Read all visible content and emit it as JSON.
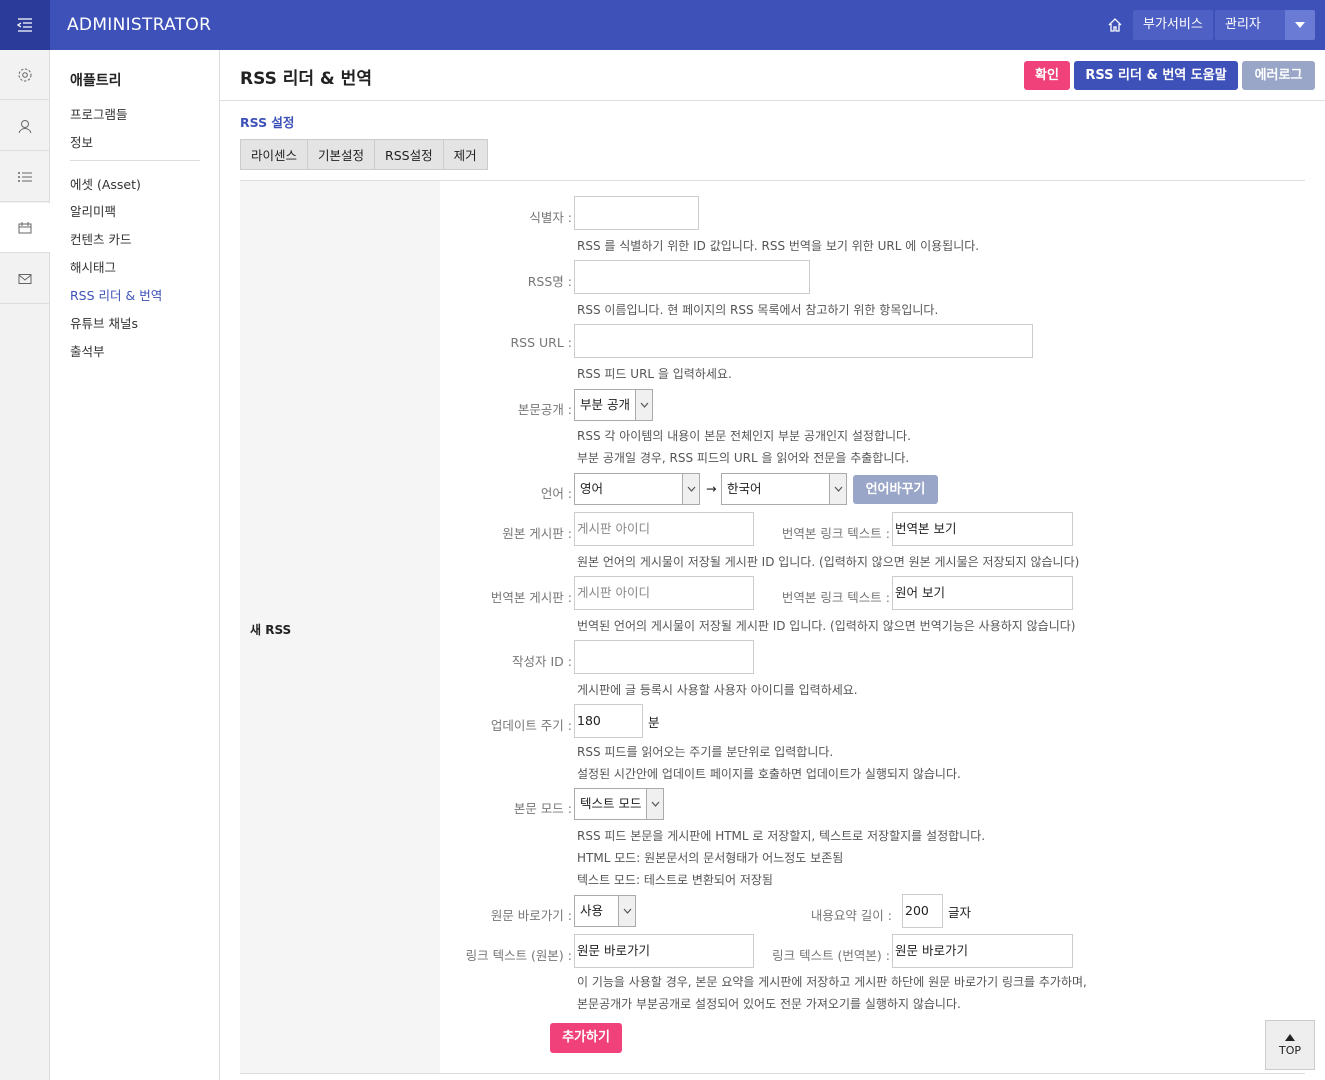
{
  "header": {
    "brand": "ADMINISTRATOR",
    "services_label": "부가서비스",
    "admin_label": "관리자"
  },
  "iconbar": [
    "gear-icon",
    "user-icon",
    "list-icon",
    "calendar-icon",
    "mail-icon"
  ],
  "sidebar": {
    "title": "애플트리",
    "items": [
      "프로그램들",
      "정보",
      "에셋 (Asset)",
      "알리미팩",
      "컨텐츠 카드",
      "해시태그",
      "RSS 리더 & 번역",
      "유튜브 채널s",
      "출석부"
    ]
  },
  "page": {
    "title": "RSS 리더 & 번역",
    "confirm_label": "확인",
    "help_label": "RSS 리더 & 번역 도움말",
    "errorlog_label": "에러로그",
    "section_label": "RSS 설정",
    "tabs": [
      "라이센스",
      "기본설정",
      "RSS설정",
      "제거"
    ]
  },
  "form": {
    "row_label": "새 RSS",
    "identifier_label": "식별자 :",
    "identifier_help": "RSS 를 식별하기 위한 ID 값입니다. RSS 번역을 보기 위한 URL 에 이용됩니다.",
    "rssname_label": "RSS명 :",
    "rssname_help": "RSS 이름입니다. 현 페이지의 RSS 목록에서 참고하기 위한 항목입니다.",
    "rssurl_label": "RSS URL :",
    "rssurl_help": "RSS 피드 URL 을 입력하세요.",
    "disclosure_label": "본문공개 :",
    "disclosure_value": "부분 공개",
    "disclosure_help1": "RSS 각 아이템의 내용이 본문 전체인지 부분 공개인지 설정합니다.",
    "disclosure_help2": "부분 공개일 경우, RSS 피드의 URL 을 읽어와 전문을 추출합니다.",
    "language_label": "언어 :",
    "lang_from": "영어",
    "lang_arrow": "→",
    "lang_to": "한국어",
    "swap_label": "언어바꾸기",
    "orig_board_label": "원본 게시판 :",
    "orig_board_placeholder": "게시판 아이디",
    "orig_link_label": "번역본 링크 텍스트 :",
    "orig_link_value": "번역본 보기",
    "orig_board_help": "원본 언어의 게시물이 저장될 게시판 ID 입니다. (입력하지 않으면 원본 게시물은 저장되지 않습니다)",
    "trans_board_label": "번역본 게시판 :",
    "trans_board_placeholder": "게시판 아이디",
    "trans_link_label": "번역본 링크 텍스트 :",
    "trans_link_value": "원어 보기",
    "trans_board_help": "번역된 언어의 게시물이 저장될 게시판 ID 입니다. (입력하지 않으면 번역기능은 사용하지 않습니다)",
    "author_label": "작성자 ID :",
    "author_help": "게시판에 글 등록시 사용할 사용자 아이디를 입력하세요.",
    "interval_label": "업데이트 주기 :",
    "interval_value": "180",
    "interval_unit": "분",
    "interval_help1": "RSS 피드를 읽어오는 주기를 분단위로 입력합니다.",
    "interval_help2": "설정된 시간안에 업데이트 페이지를 호출하면 업데이트가 실행되지 않습니다.",
    "mode_label": "본문 모드 :",
    "mode_value": "텍스트 모드",
    "mode_help1": "RSS 피드 본문을 게시판에 HTML 로 저장할지, 텍스트로 저장할지를 설정합니다.",
    "mode_help2": "HTML 모드: 원본문서의 문서형태가 어느정도 보존됨",
    "mode_help3": "텍스트 모드: 테스트로 변환되어 저장됨",
    "shortcut_label": "원문 바로가기 :",
    "shortcut_value": "사용",
    "summary_label": "내용요약 길이 :",
    "summary_value": "200",
    "summary_unit": "글자",
    "linktext_orig_label": "링크 텍스트 (원본) :",
    "linktext_orig_value": "원문 바로가기",
    "linktext_trans_label": "링크 텍스트 (번역본) :",
    "linktext_trans_value": "원문 바로가기",
    "shortcut_help1": "이 기능을 사용할 경우, 본문 요약을 게시판에 저장하고 게시판 하단에 원문 바로가기 링크를 추가하며,",
    "shortcut_help2": "본문공개가 부분공개로 설정되어 있어도 전문 가져오기를 실행하지 않습니다.",
    "add_label": "추가하기"
  },
  "top_label": "TOP",
  "colors": {
    "primary": "#3d51b8",
    "pink": "#f0417a",
    "gray": "#9aa6c8"
  }
}
